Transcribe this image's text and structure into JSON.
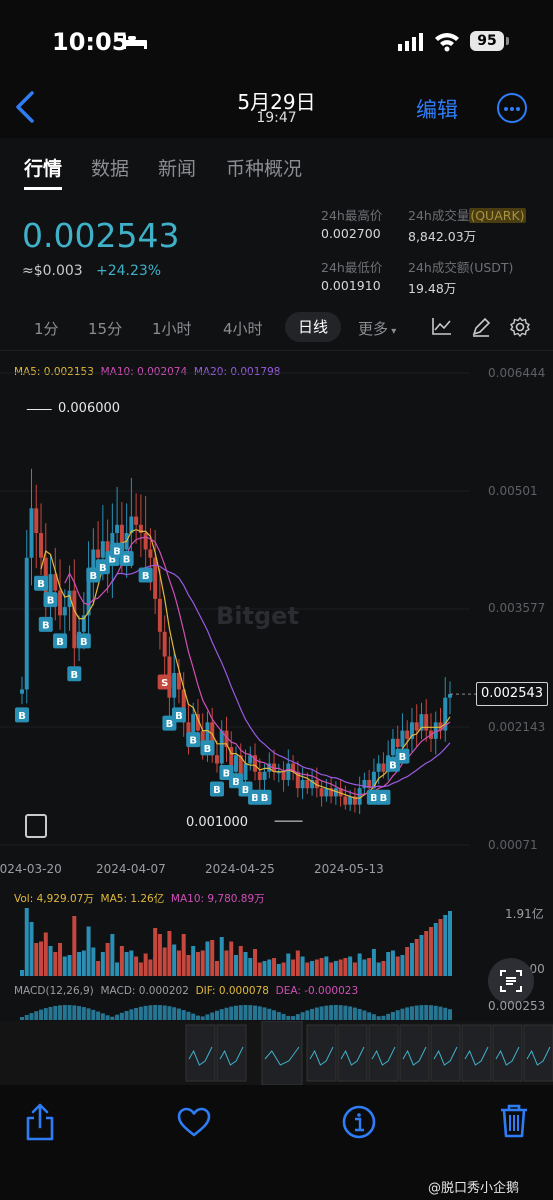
{
  "status_bar": {
    "time": "10:05",
    "battery": "95"
  },
  "photo_nav": {
    "date": "5月29日",
    "time": "19:47",
    "edit_label": "编辑"
  },
  "tabs": [
    "行情",
    "数据",
    "新闻",
    "币种概况"
  ],
  "ticker": {
    "price": "0.002543",
    "usd": "≈$0.003",
    "change": "+24.23%",
    "high_label": "24h最高价",
    "high": "0.002700",
    "low_label": "24h最低价",
    "low": "0.001910",
    "vol_label": "24h成交量",
    "vol_unit": "(QUARK)",
    "vol": "8,842.03万",
    "amount_label": "24h成交额(USDT)",
    "amount": "19.48万"
  },
  "timeframes": [
    "1分",
    "15分",
    "1小时",
    "4小时",
    "日线",
    "更多"
  ],
  "ma_legend": {
    "ma5": "MA5: 0.002153",
    "ma10": "MA10: 0.002074",
    "ma20": "MA20: 0.001798"
  },
  "vol_legend": {
    "vol": "Vol: 4,929.07万",
    "ma5": "MA5: 1.26亿",
    "ma10": "MA10: 9,780.89万"
  },
  "macd_legend": {
    "title": "MACD(12,26,9)",
    "macd": "MACD: 0.000202",
    "dif": "DIF: 0.000078",
    "dea": "DEA: -0.000023"
  },
  "watermark_text": "Bitget",
  "weibo": "@脱口秀小企鹅",
  "colors": {
    "up": "#2a8fb4",
    "down": "#c5473e",
    "accent": "#3fb1c9",
    "ios_blue": "#2f7df6",
    "ma5": "#e2b93b",
    "ma10": "#d04fb8",
    "ma20": "#9a5be0"
  },
  "chart_data": {
    "type": "candlestick",
    "title": "",
    "x_ticks": [
      "2024-03-20",
      "2024-04-07",
      "2024-04-25",
      "2024-05-13"
    ],
    "y_ticks": [
      0.006444,
      0.00501,
      0.003577,
      0.002143,
      0.00071
    ],
    "current_price": 0.002543,
    "annotations": [
      {
        "label": "0.006000",
        "value": 0.006
      },
      {
        "label": "0.001000",
        "value": 0.001
      }
    ],
    "volume_axis": [
      "1.91亿",
      "0.00"
    ],
    "macd_axis": [
      "0.000253"
    ],
    "ylim": [
      0.00071,
      0.006444
    ],
    "closes": [
      0.0026,
      0.0042,
      0.0048,
      0.0045,
      0.0042,
      0.0037,
      0.004,
      0.0038,
      0.0035,
      0.0036,
      0.0038,
      0.0031,
      0.0033,
      0.0035,
      0.004,
      0.0043,
      0.0042,
      0.0044,
      0.0041,
      0.0045,
      0.0046,
      0.0043,
      0.0045,
      0.0047,
      0.0046,
      0.0045,
      0.0043,
      0.0042,
      0.0037,
      0.0033,
      0.003,
      0.0025,
      0.0028,
      0.0026,
      0.0022,
      0.002,
      0.0023,
      0.0021,
      0.0019,
      0.0022,
      0.0018,
      0.0017,
      0.0021,
      0.0019,
      0.0016,
      0.0018,
      0.0015,
      0.0017,
      0.0018,
      0.0016,
      0.0015,
      0.0016,
      0.0017,
      0.0016,
      0.0016,
      0.0015,
      0.0017,
      0.0016,
      0.0014,
      0.0015,
      0.0014,
      0.0015,
      0.0014,
      0.0013,
      0.0014,
      0.0013,
      0.0014,
      0.0013,
      0.0012,
      0.0013,
      0.0012,
      0.0014,
      0.0015,
      0.0014,
      0.0016,
      0.0017,
      0.0016,
      0.0018,
      0.002,
      0.0019,
      0.0021,
      0.002,
      0.0022,
      0.0021,
      0.0023,
      0.0021,
      0.002,
      0.0022,
      0.0021,
      0.0025,
      0.002543
    ]
  }
}
